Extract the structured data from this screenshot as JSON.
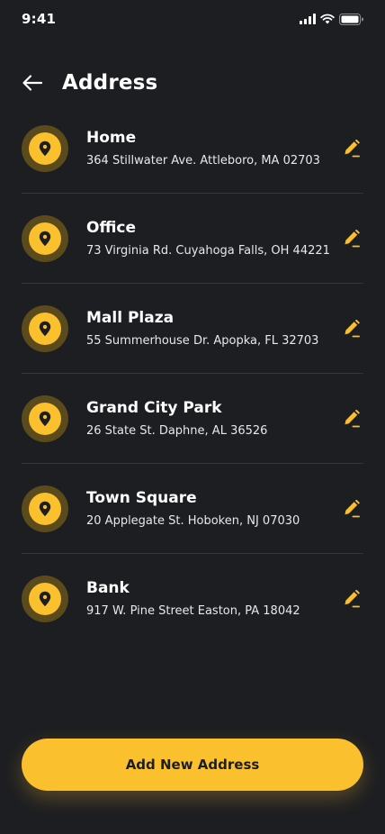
{
  "status_bar": {
    "time": "9:41",
    "icons": [
      "signal-icon",
      "wifi-icon",
      "battery-icon"
    ]
  },
  "header": {
    "back_icon": "arrow-left-icon",
    "title": "Address"
  },
  "addresses": [
    {
      "name": "Home",
      "address": "364 Stillwater Ave. Attleboro, MA 02703"
    },
    {
      "name": "Office",
      "address": "73 Virginia Rd. Cuyahoga Falls, OH 44221"
    },
    {
      "name": "Mall Plaza",
      "address": "55 Summerhouse Dr. Apopka, FL 32703"
    },
    {
      "name": "Grand City Park",
      "address": "26 State St. Daphne, AL 36526"
    },
    {
      "name": "Town Square",
      "address": "20 Applegate St. Hoboken, NJ 07030"
    },
    {
      "name": "Bank",
      "address": "917 W. Pine Street Easton, PA 18042"
    }
  ],
  "add_button_label": "Add New Address",
  "colors": {
    "background": "#1d1e22",
    "accent": "#fbc02d",
    "pin_ring": "#5a4a1c",
    "divider": "#34363b"
  }
}
